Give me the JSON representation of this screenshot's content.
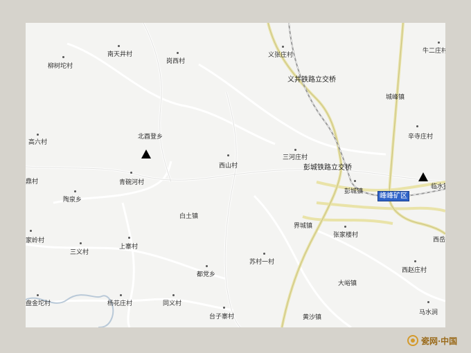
{
  "map": {
    "labels": {
      "liuhuzhuang": "柳树坨村",
      "dongtianjingcun": "南天井村",
      "gangxicun": "岗西村",
      "yizhangzhuang": "义张庄村",
      "yijing_overpass": "义井铁路立交桥",
      "niuerzhuang": "牛二庄村",
      "chengfeng": "城峰镇",
      "xinchunzhuang": "辛寺庄村",
      "gaoliu": "高六村",
      "beiyi": "北酉登乡",
      "sanhezhuang": "三河庄村",
      "pengcheng_overpass": "彭城铁路立交桥",
      "xishan": "西山村",
      "qingfeng": "青碗河村",
      "dinlang": "鼎村",
      "taiquan": "陶泉乡",
      "pengcheng": "彭城镇",
      "fengfeng": "峰峰矿区",
      "linshui": "临水镇",
      "baitu": "白土镇",
      "jiecheng": "界城镇",
      "jialing": "家岭村",
      "zhangjialou": "张家楼村",
      "xixi": "西岳",
      "sanyi": "三义村",
      "shangzhai": "上寨村",
      "sucunyi": "苏村一村",
      "doudang": "都党乡",
      "xizhuangzhuang": "西赵庄村",
      "dayu": "大峪镇",
      "panjinbo": "盘金坨村",
      "yanghuazhuang": "杨花庄村",
      "tongyi": "同义村",
      "taizizhai": "台子寨村",
      "huangsha": "黄沙镇",
      "mashui": "马水涧"
    }
  },
  "watermark": {
    "text": "瓷网·中国"
  }
}
